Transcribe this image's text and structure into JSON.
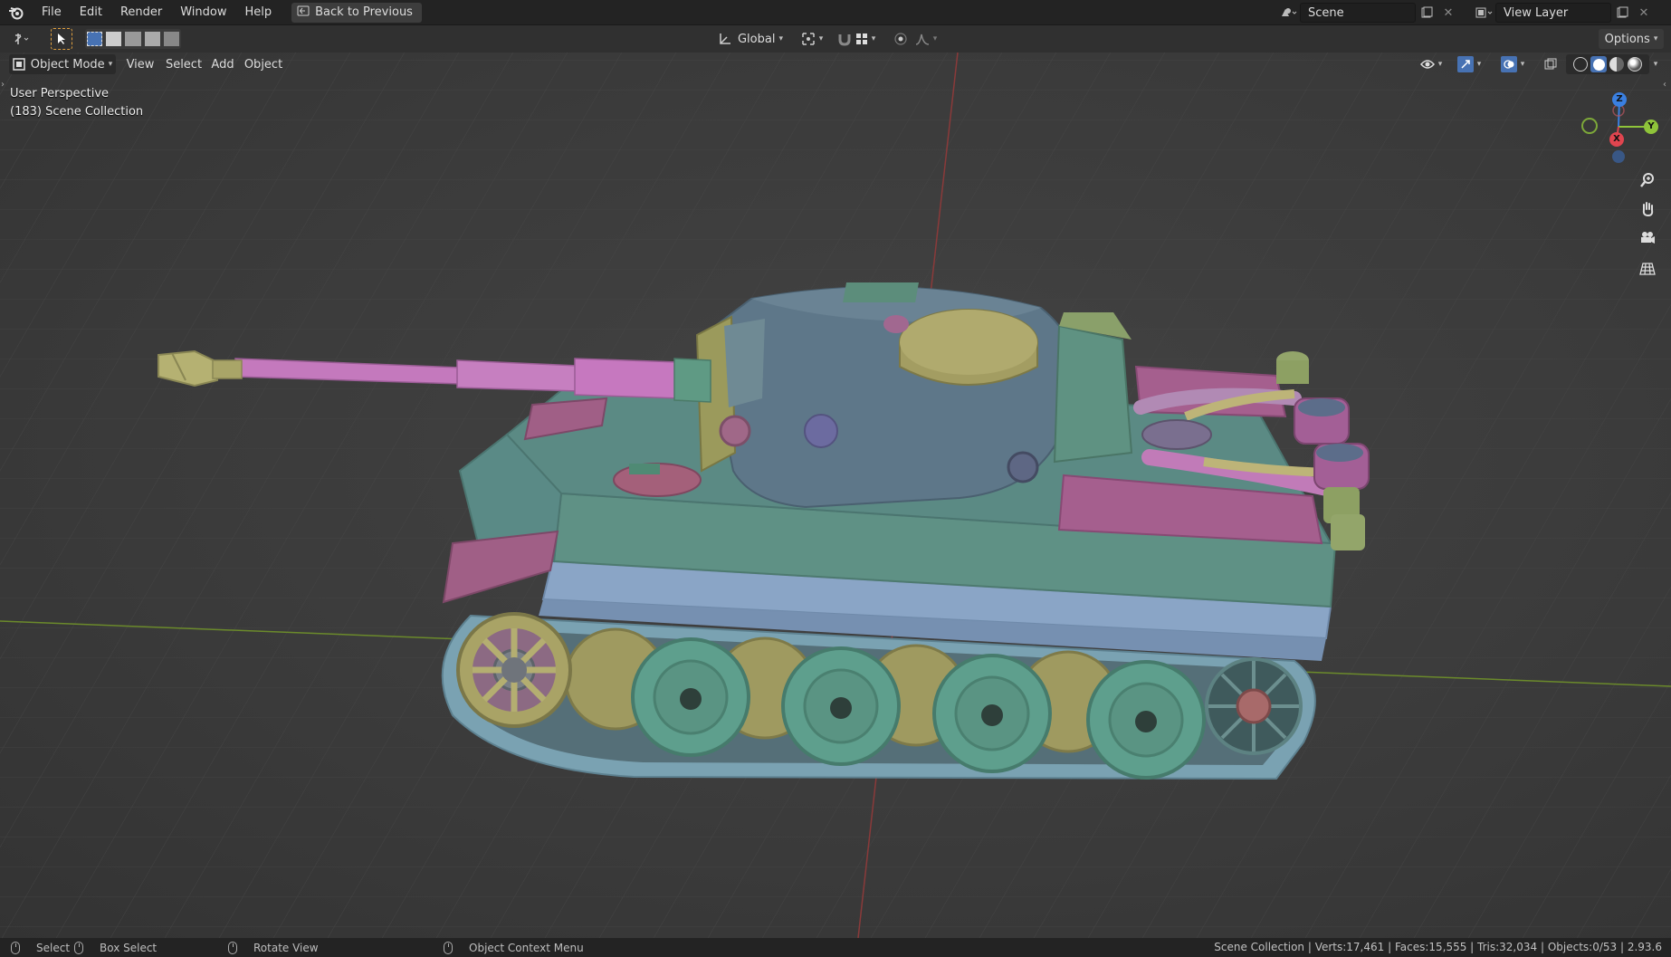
{
  "menu": {
    "items": [
      "File",
      "Edit",
      "Render",
      "Window",
      "Help"
    ],
    "back_label": "Back to Previous"
  },
  "topright": {
    "scene_label": "Scene",
    "view_layer_label": "View Layer"
  },
  "toolbar": {
    "orientation": "Global",
    "options_label": "Options"
  },
  "header": {
    "mode": "Object Mode",
    "menus": [
      "View",
      "Select",
      "Add",
      "Object"
    ]
  },
  "viewport": {
    "perspective": "User Perspective",
    "collection": "(183) Scene Collection",
    "gizmo": {
      "z": "Z",
      "y": "Y",
      "x": "X"
    }
  },
  "status": {
    "select": "Select",
    "box_select": "Box Select",
    "rotate": "Rotate View",
    "context": "Object Context Menu",
    "stats": "Scene Collection | Verts:17,461 | Faces:15,555 | Tris:32,034 | Objects:0/53 | 2.93.6"
  },
  "colors": {
    "hull": "#5b8a84",
    "turret": "#5f7889",
    "barrel": "#c87bc0",
    "olive": "#a8a46b",
    "magenta_plate": "#a55f8e",
    "wheel": "#5a9a8a",
    "track": "#7f9fae",
    "axis_x": "#e0454f",
    "axis_y": "#8fc43a",
    "axis_z": "#3a7fe0"
  }
}
